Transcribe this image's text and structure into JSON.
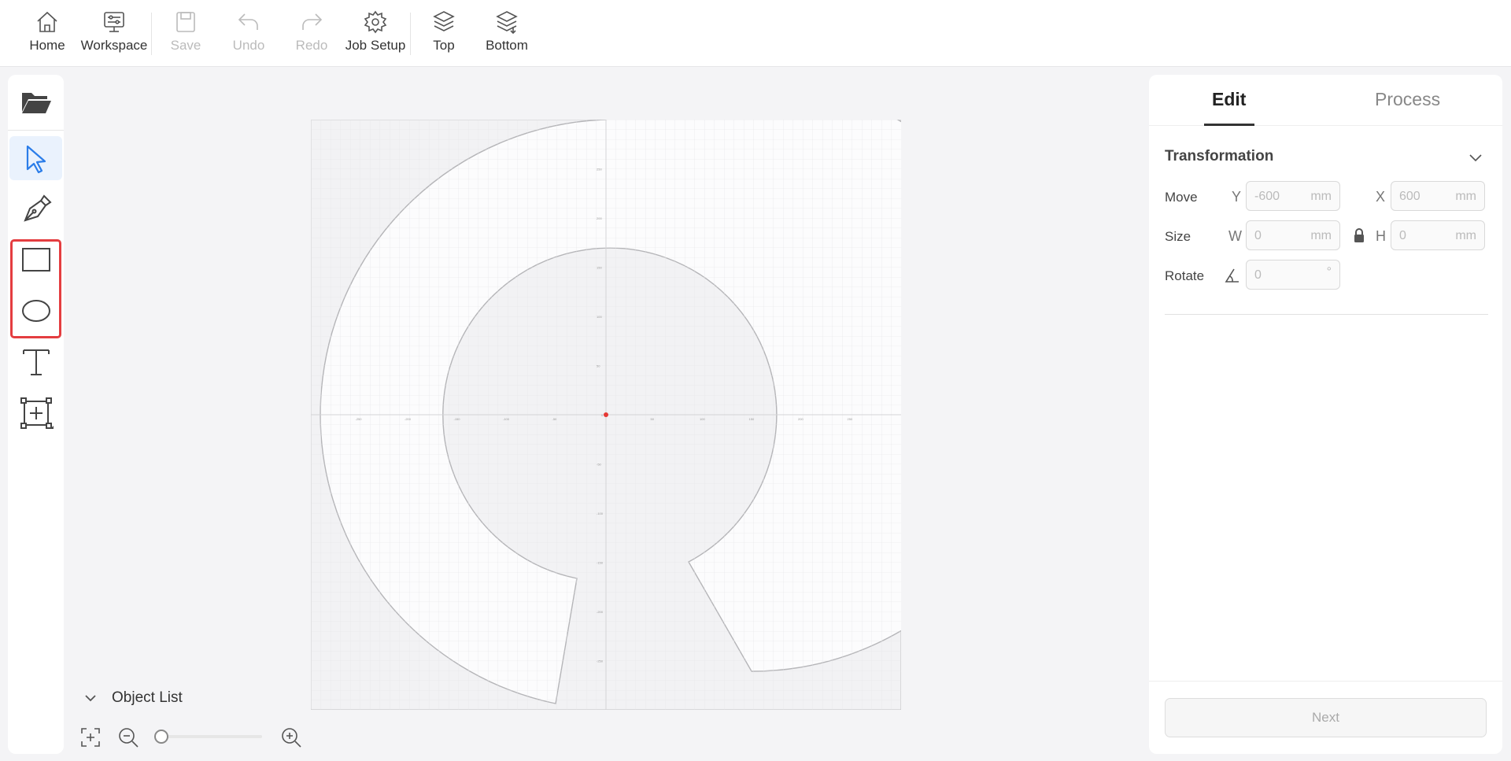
{
  "toolbar": {
    "home": "Home",
    "workspace": "Workspace",
    "save": "Save",
    "undo": "Undo",
    "redo": "Redo",
    "job_setup": "Job Setup",
    "top": "Top",
    "bottom": "Bottom"
  },
  "left_tools": [
    "open-folder-icon",
    "select-arrow-icon",
    "pen-icon",
    "rectangle-icon",
    "ellipse-icon",
    "text-icon",
    "add-frame-icon"
  ],
  "canvas": {
    "origin_label": "0",
    "x_ticks": [
      "-250",
      "-200",
      "-150",
      "-100",
      "-50",
      "50",
      "100",
      "150",
      "200",
      "250"
    ],
    "y_ticks": [
      "250",
      "200",
      "150",
      "100",
      "50",
      "-50",
      "-100",
      "-150",
      "-200",
      "-250"
    ],
    "origin_color": "#e53935"
  },
  "object_list": {
    "label": "Object List"
  },
  "right_panel": {
    "tabs": [
      "Edit",
      "Process"
    ],
    "section": "Transformation",
    "move": {
      "label": "Move",
      "y_axis": "Y",
      "y_value": "-600",
      "x_axis": "X",
      "x_value": "600",
      "unit": "mm"
    },
    "size": {
      "label": "Size",
      "w_axis": "W",
      "w_value": "0",
      "h_axis": "H",
      "h_value": "0",
      "unit": "mm"
    },
    "rotate": {
      "label": "Rotate",
      "value": "0",
      "unit": "°"
    },
    "next_button": "Next"
  },
  "colors": {
    "accent": "#2b7de9",
    "highlight": "#e43d40"
  }
}
